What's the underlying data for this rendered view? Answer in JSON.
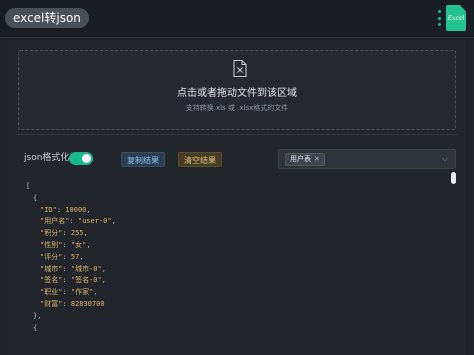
{
  "header": {
    "title": "excel转json",
    "logo_text": "Excel"
  },
  "dropzone": {
    "icon": "file-x-icon",
    "title": "点击或者拖动文件到该区域",
    "subtitle": "支持转换.xls 或 .xlsx格式的文件"
  },
  "toolbar": {
    "format_label": "json格式化",
    "format_enabled": true,
    "copy_label": "复制结果",
    "clear_label": "清空结果",
    "sheet_tag": "用户表"
  },
  "json_lines": [
    {
      "indent": 0,
      "text": "["
    },
    {
      "indent": 1,
      "text": "{"
    },
    {
      "indent": 2,
      "key": "\"ID\"",
      "value": "10000",
      "comma": true
    },
    {
      "indent": 2,
      "key": "\"用户名\"",
      "value": "\"user-0\"",
      "comma": true
    },
    {
      "indent": 2,
      "key": "\"积分\"",
      "value": "255",
      "comma": true
    },
    {
      "indent": 2,
      "key": "\"性别\"",
      "value": "\"女\"",
      "comma": true
    },
    {
      "indent": 2,
      "key": "\"评分\"",
      "value": "57",
      "comma": true
    },
    {
      "indent": 2,
      "key": "\"城市\"",
      "value": "\"城市-0\"",
      "comma": true
    },
    {
      "indent": 2,
      "key": "\"签名\"",
      "value": "\"签名-0\"",
      "comma": true
    },
    {
      "indent": 2,
      "key": "\"职业\"",
      "value": "\"作家\"",
      "comma": true
    },
    {
      "indent": 2,
      "key": "\"财富\"",
      "value": "82830700",
      "comma": false
    },
    {
      "indent": 1,
      "text": "},"
    },
    {
      "indent": 1,
      "text": "{"
    }
  ],
  "colors": {
    "accent": "#17b98a",
    "json_value": "#e0b46c",
    "background": "#1f2327"
  }
}
